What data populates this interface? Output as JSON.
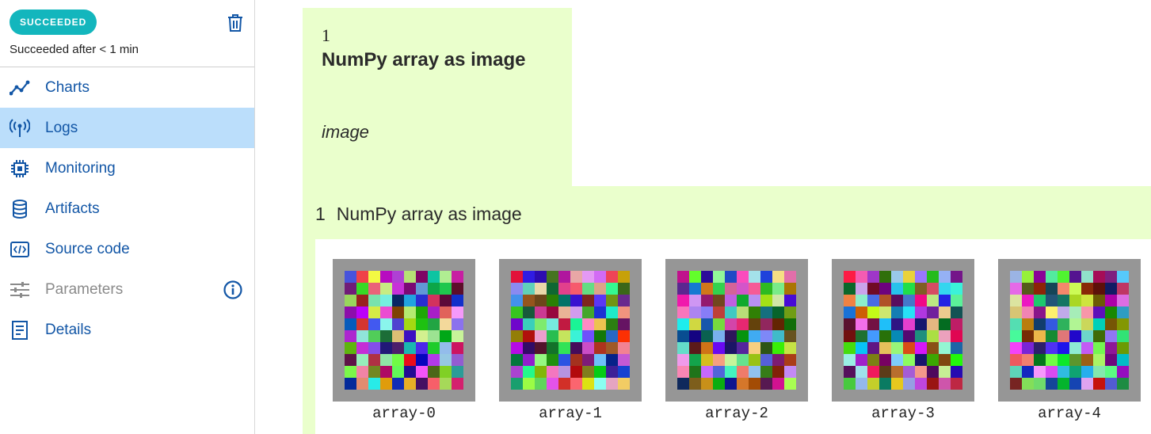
{
  "sidebar": {
    "status_badge": "SUCCEEDED",
    "status_text": "Succeeded after < 1 min",
    "items": [
      {
        "label": "Charts",
        "icon": "chart-line-icon"
      },
      {
        "label": "Logs",
        "icon": "broadcast-icon"
      },
      {
        "label": "Monitoring",
        "icon": "chip-icon"
      },
      {
        "label": "Artifacts",
        "icon": "database-icon"
      },
      {
        "label": "Source code",
        "icon": "code-file-icon"
      },
      {
        "label": "Parameters",
        "icon": "sliders-icon"
      },
      {
        "label": "Details",
        "icon": "document-list-icon"
      }
    ],
    "active_item": "Logs",
    "colors": {
      "badge": "#13b6bd",
      "link": "#1256a6",
      "active_bg": "#bbdefb"
    }
  },
  "markdown_cell": {
    "number": "1",
    "heading": "NumPy array as image",
    "italic_text": "image",
    "background": "#eaffcc"
  },
  "output_cell": {
    "number": "1",
    "title": "NumPy array as image",
    "images": [
      {
        "caption": "array-0"
      },
      {
        "caption": "array-1"
      },
      {
        "caption": "array-2"
      },
      {
        "caption": "array-3"
      },
      {
        "caption": "array-4"
      }
    ]
  }
}
